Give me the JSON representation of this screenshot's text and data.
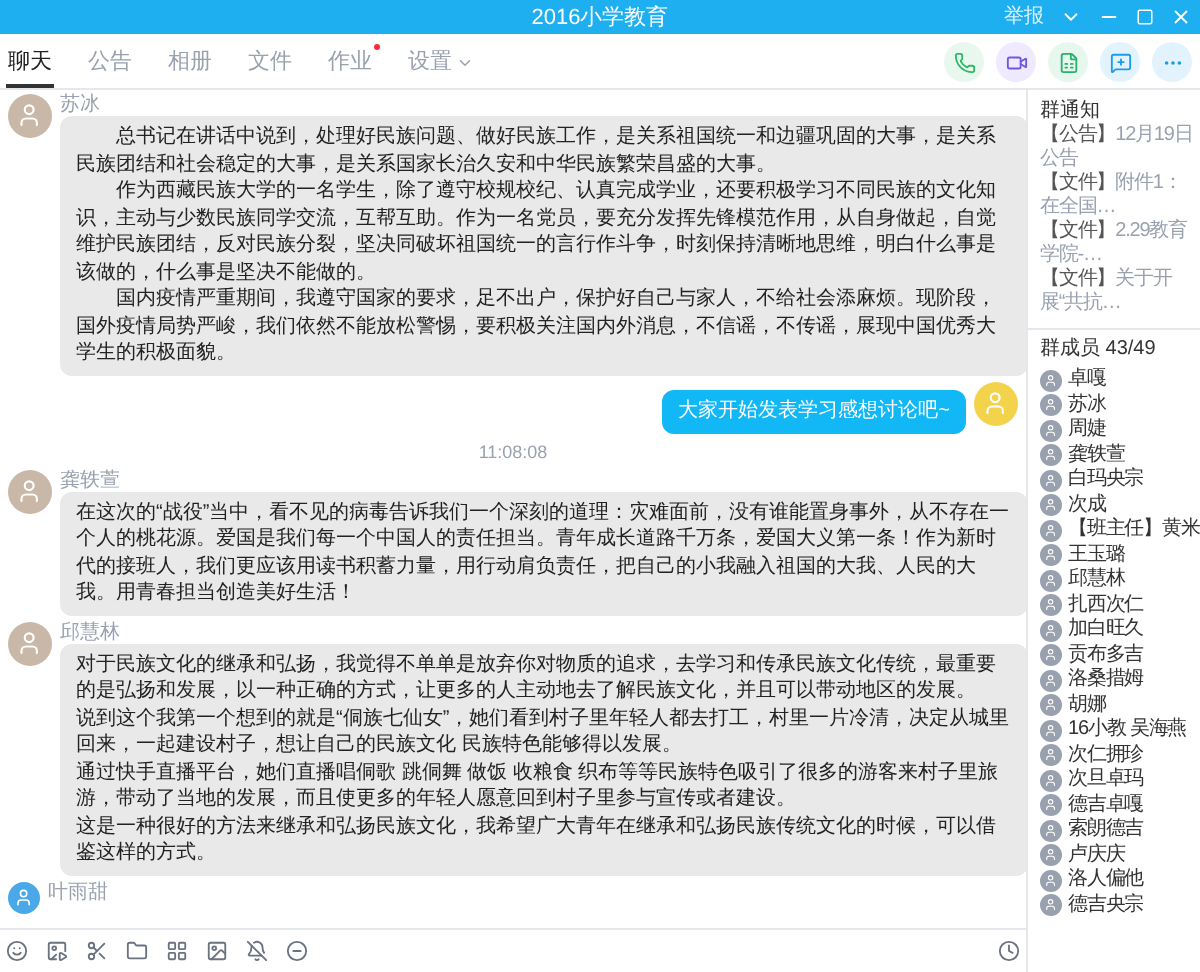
{
  "window": {
    "title": "2016小学教育",
    "report": "举报"
  },
  "tabs": [
    {
      "label": "聊天",
      "selected": true,
      "dot": false,
      "menu": false
    },
    {
      "label": "公告",
      "selected": false,
      "dot": false,
      "menu": false
    },
    {
      "label": "相册",
      "selected": false,
      "dot": false,
      "menu": false
    },
    {
      "label": "文件",
      "selected": false,
      "dot": false,
      "menu": false
    },
    {
      "label": "作业",
      "selected": false,
      "dot": true,
      "menu": false
    },
    {
      "label": "设置",
      "selected": false,
      "dot": false,
      "menu": true
    }
  ],
  "messages": [
    {
      "kind": "incoming",
      "sender": "苏冰",
      "indented": true,
      "paragraphs": [
        "总书记在讲话中说到，处理好民族问题、做好民族工作，是关系祖国统一和边疆巩固的大事，是关系民族团结和社会稳定的大事，是关系国家长治久安和中华民族繁荣昌盛的大事。",
        "作为西藏民族大学的一名学生，除了遵守校规校纪、认真完成学业，还要积极学习不同民族的文化知识，主动与少数民族同学交流，互帮互助。作为一名党员，要充分发挥先锋模范作用，从自身做起，自觉维护民族团结，反对民族分裂，坚决同破坏祖国统一的言行作斗争，时刻保持清晰地思维，明白什么事是该做的，什么事是坚决不能做的。",
        "国内疫情严重期间，我遵守国家的要求，足不出户，保护好自己与家人，不给社会添麻烦。现阶段，国外疫情局势严峻，我们依然不能放松警惕，要积极关注国内外消息，不信谣，不传谣，展现中国优秀大学生的积极面貌。"
      ]
    },
    {
      "kind": "outgoing",
      "paragraphs": [
        "大家开始发表学习感想讨论吧~"
      ]
    },
    {
      "kind": "time",
      "text": "11:08:08"
    },
    {
      "kind": "incoming",
      "sender": "龚轶萱",
      "indented": false,
      "paragraphs": [
        "在这次的“战役”当中，看不见的病毒告诉我们一个深刻的道理：灾难面前，没有谁能置身事外，从不存在一个人的桃花源。爱国是我们每一个中国人的责任担当。青年成长道路千万条，爱国大义第一条！作为新时代的接班人，我们更应该用读书积蓄力量，用行动肩负责任，把自己的小我融入祖国的大我、人民的大我。用青春担当创造美好生活！"
      ]
    },
    {
      "kind": "incoming",
      "sender": "邱慧林",
      "indented": false,
      "paragraphs": [
        "对于民族文化的继承和弘扬，我觉得不单单是放弃你对物质的追求，去学习和传承民族文化传统，最重要的是弘扬和发展，以一种正确的方式，让更多的人主动地去了解民族文化，并且可以带动地区的发展。",
        "说到这个我第一个想到的就是“侗族七仙女”，她们看到村子里年轻人都去打工，村里一片冷清，决定从城里回来，一起建设村子，想让自己的民族文化 民族特色能够得以发展。",
        "通过快手直播平台，她们直播唱侗歌 跳侗舞 做饭 收粮食 织布等等民族特色吸引了很多的游客来村子里旅游，带动了当地的发展，而且使更多的年轻人愿意回到村子里参与宣传或者建设。",
        "这是一种很好的方法来继承和弘扬民族文化，我希望广大青年在继承和弘扬民族传统文化的时候，可以借鉴这样的方式。"
      ]
    },
    {
      "kind": "partial",
      "sender": "叶雨甜"
    }
  ],
  "notices": {
    "title": "群通知",
    "items": [
      {
        "tag": "【公告】",
        "text": "12月19日公告"
      },
      {
        "tag": "【文件】",
        "text": "附件1：在全国…"
      },
      {
        "tag": "【文件】",
        "text": "2.29教育学院-…"
      },
      {
        "tag": "【文件】",
        "text": "关于开展“共抗…"
      }
    ]
  },
  "members": {
    "title": "群成员 43/49",
    "items": [
      "卓嘎",
      "苏冰",
      "周婕",
      "龚轶萱",
      "白玛央宗",
      "次成",
      "【班主任】黄米",
      "王玉璐",
      "邱慧林",
      "扎西次仁",
      "加白旺久",
      "贡布多吉",
      "洛桑措姆",
      "胡娜",
      "16小教 吴海燕",
      "次仁拥珍",
      "次旦卓玛",
      "德吉卓嘎",
      "索朗德吉",
      "卢庆庆",
      "洛人偏他",
      "德吉央宗"
    ]
  }
}
